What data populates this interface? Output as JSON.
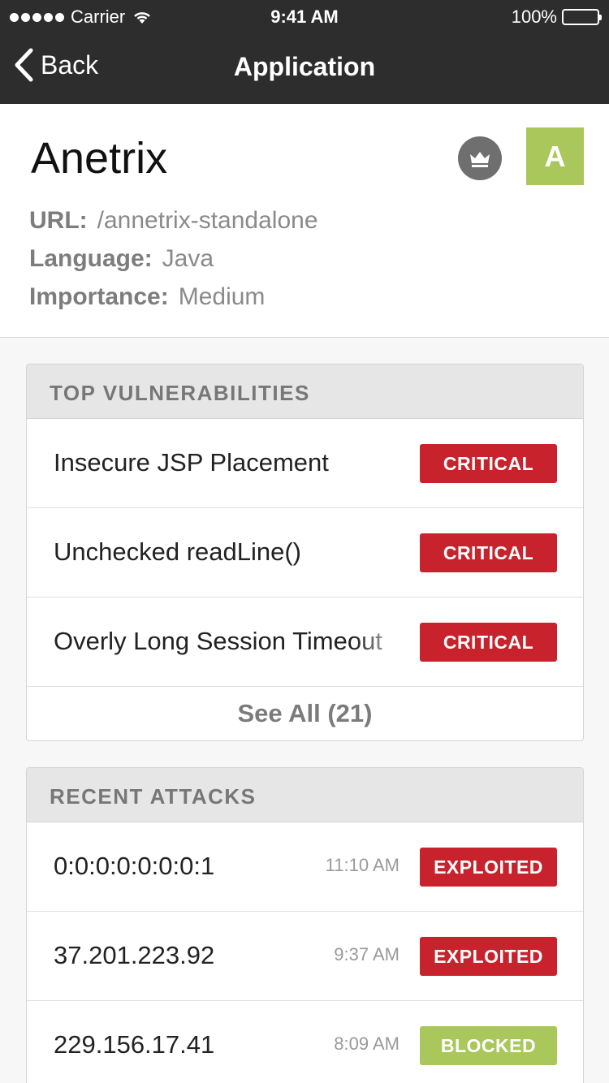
{
  "status_bar": {
    "carrier": "Carrier",
    "time": "9:41 AM",
    "battery": "100%"
  },
  "nav": {
    "back_label": "Back",
    "title": "Application"
  },
  "app": {
    "name": "Anetrix",
    "grade": "A",
    "url_label": "URL:",
    "url": "/annetrix-standalone",
    "language_label": "Language:",
    "language": "Java",
    "importance_label": "Importance:",
    "importance": "Medium"
  },
  "vulnerabilities": {
    "heading": "TOP VULNERABILITIES",
    "items": [
      {
        "name": "Insecure JSP Placement",
        "severity": "CRITICAL"
      },
      {
        "name": "Unchecked readLine()",
        "severity": "CRITICAL"
      },
      {
        "name": "Overly Long Session Timeout",
        "severity": "CRITICAL"
      }
    ],
    "see_all": "See All (21)"
  },
  "attacks": {
    "heading": "RECENT ATTACKS",
    "items": [
      {
        "ip": "0:0:0:0:0:0:0:1",
        "time": "11:10 AM",
        "status": "EXPLOITED"
      },
      {
        "ip": "37.201.223.92",
        "time": "9:37 AM",
        "status": "EXPLOITED"
      },
      {
        "ip": "229.156.17.41",
        "time": "8:09 AM",
        "status": "BLOCKED"
      }
    ]
  },
  "colors": {
    "critical": "#c8222c",
    "blocked": "#a9c75a",
    "grade": "#a9c75a",
    "bar": "#2d2d2d"
  }
}
